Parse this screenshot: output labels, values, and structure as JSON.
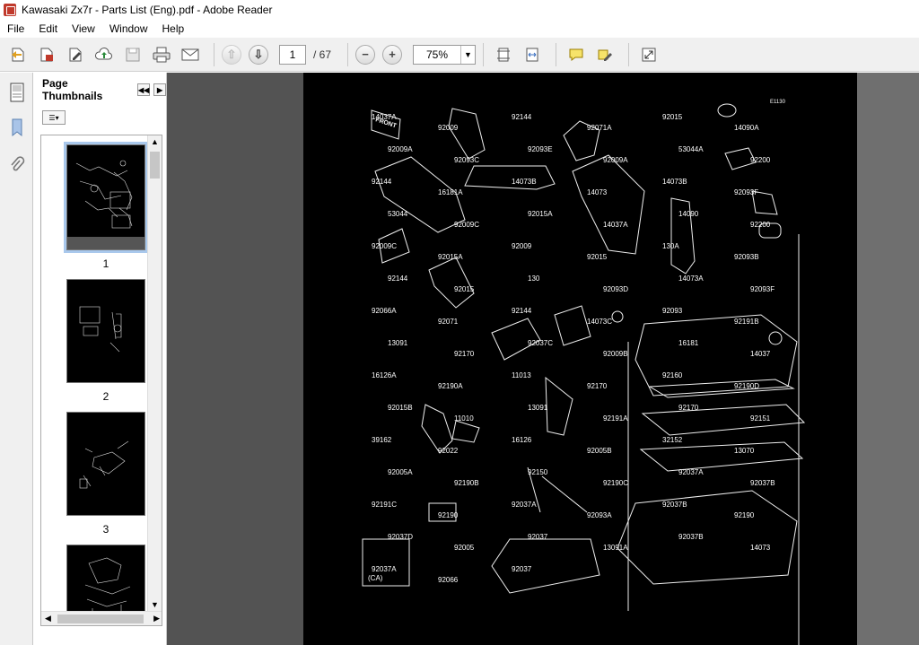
{
  "window": {
    "title": "Kawasaki Zx7r - Parts List (Eng).pdf - Adobe Reader"
  },
  "menu": [
    "File",
    "Edit",
    "View",
    "Window",
    "Help"
  ],
  "toolbar": {
    "page_current": "1",
    "page_total": "/ 67",
    "zoom": "75%"
  },
  "thumbnails": {
    "title": "Page Thumbnails",
    "items": [
      {
        "label": "1"
      },
      {
        "label": "2"
      },
      {
        "label": "3"
      }
    ]
  },
  "page": {
    "code": "E1130",
    "front_label": "FRONT",
    "callouts": [
      "14037A",
      "92009",
      "92144",
      "92071A",
      "92015",
      "14090A",
      "92009A",
      "92093C",
      "92093E",
      "92009A",
      "53044A",
      "92200",
      "92144",
      "16181A",
      "14073B",
      "14073",
      "14073B",
      "92093F",
      "53044",
      "92009C",
      "92015A",
      "14037A",
      "14090",
      "92200",
      "92009C",
      "92015A",
      "92009",
      "92015",
      "130A",
      "92093B",
      "92144",
      "92015",
      "130",
      "92093D",
      "14073A",
      "92093F",
      "92066A",
      "92071",
      "92144",
      "14073C",
      "92093",
      "92191B",
      "13091",
      "92170",
      "92037C",
      "92009B",
      "16181",
      "14037",
      "16126A",
      "92190A",
      "11013",
      "92170",
      "92160",
      "92190D",
      "92015B",
      "11010",
      "13091",
      "92191A",
      "92170",
      "92151",
      "39162",
      "92022",
      "16126",
      "92005B",
      "32152",
      "13070",
      "92005A",
      "92190B",
      "92150",
      "92190C",
      "92037A",
      "92037B",
      "92191C",
      "92190",
      "92037A",
      "92093A",
      "92037B",
      "92190",
      "92037D",
      "92005",
      "92037",
      "13091A",
      "92037B",
      "14073",
      "92037A",
      "92066",
      "92037"
    ],
    "ca_label": "(CA)"
  }
}
